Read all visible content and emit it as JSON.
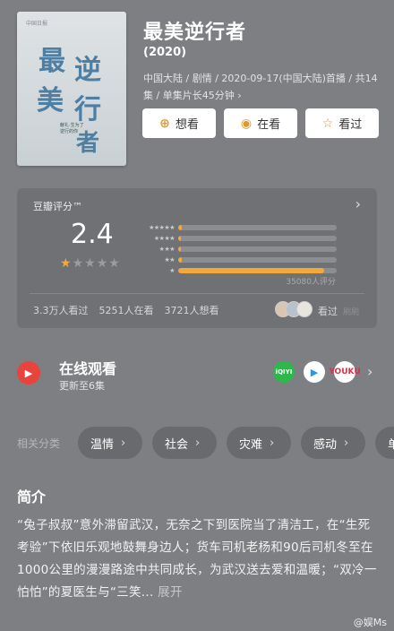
{
  "movie": {
    "title": "最美逆行者",
    "year": "(2020)",
    "meta": "中国大陆 / 剧情 / 2020-09-17(中国大陆)首播 / 共14集 / 单集片长45分钟 ›",
    "poster_text": [
      "最",
      "逆",
      "美",
      "行",
      "者"
    ],
    "poster_tag": "献礼·生为了逆行的你",
    "poster_top": "中国日报"
  },
  "actions": {
    "want": "想看",
    "watching": "在看",
    "watched": "看过",
    "want_icon": "plus-icon",
    "watching_icon": "target-icon",
    "watched_icon": "star-icon"
  },
  "rating": {
    "label": "豆瓣评分™",
    "score": "2.4",
    "stars_filled": 1,
    "stars_total": 5,
    "distribution": [
      {
        "stars": "★★★★★",
        "fraction": 0.02
      },
      {
        "stars": "★★★★",
        "fraction": 0.015
      },
      {
        "stars": "★★★",
        "fraction": 0.015
      },
      {
        "stars": "★★",
        "fraction": 0.02
      },
      {
        "stars": "★",
        "fraction": 0.92
      }
    ],
    "count": "35080人评分",
    "stats": [
      "3.3万人看过",
      "5251人在看",
      "3721人想看"
    ],
    "seen_label": "看过",
    "seen_ghost": "刷刷"
  },
  "watch": {
    "title": "在线观看",
    "subtitle": "更新至6集",
    "platforms": [
      "iQIYI",
      "▶",
      "YOUKU"
    ],
    "accent": "#e8443d"
  },
  "categories": {
    "label": "相关分类",
    "items": [
      "温情",
      "社会",
      "灾难",
      "感动",
      "单"
    ]
  },
  "synopsis": {
    "title": "简介",
    "text": "“兔子叔叔”意外滞留武汉，无奈之下到医院当了清洁工，在“生死考验”下依旧乐观地鼓舞身边人；货车司机老杨和90后司机冬至在1000公里的漫漫路途中共同成长，为武汉送去爱和温暖；“双冷一怕怕”的夏医生与“三笑...",
    "more": "展开"
  },
  "watermark": "@娱Ms"
}
